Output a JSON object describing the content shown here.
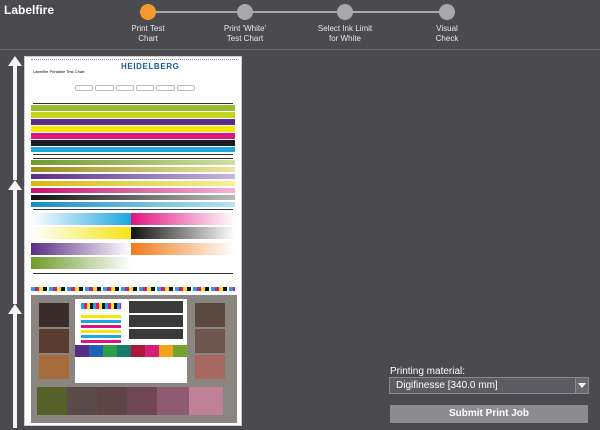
{
  "app": {
    "title": "Labelfire"
  },
  "steps": [
    {
      "label": "Print Test\nChart",
      "state": "active"
    },
    {
      "label": "Print 'White'\nTest Chart",
      "state": "pending"
    },
    {
      "label": "Select Ink Limit\nfor White",
      "state": "pending"
    },
    {
      "label": "Visual\nCheck",
      "state": "pending"
    }
  ],
  "chart_preview": {
    "brand": "HEIDELBERG",
    "header": "Labelfire Printable Test Chart"
  },
  "printing_material": {
    "label": "Printing material:",
    "selected": "Digifinesse [340.0 mm]"
  },
  "actions": {
    "submit_label": "Submit Print Job"
  },
  "colors": {
    "accent": "#f39a2c",
    "background": "#4a4a4f",
    "step_idle": "#a8a8ac",
    "button": "#8c8c90"
  }
}
